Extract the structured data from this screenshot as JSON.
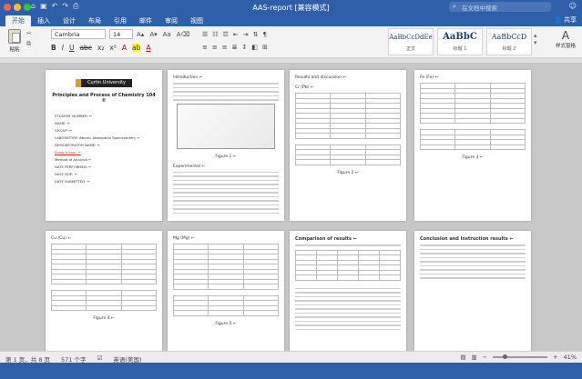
{
  "window": {
    "title": "AAS-report [兼容模式]",
    "search_placeholder": "在文档中搜索"
  },
  "tabs": [
    "开始",
    "插入",
    "设计",
    "布局",
    "引用",
    "邮件",
    "审阅",
    "视图"
  ],
  "share_label": "共享",
  "ribbon": {
    "paste_label": "粘贴",
    "font": "Cambria",
    "size": "14",
    "styles": [
      {
        "preview": "AaBbCcDdEe",
        "name": "正文"
      },
      {
        "preview": "AaBbC",
        "name": "标题 1"
      },
      {
        "preview": "AaBbCcD",
        "name": "标题 2"
      }
    ],
    "style_pane_label": "样式窗格"
  },
  "pages": {
    "cover": {
      "logo_text": "Curtin University",
      "title": "Principles and Process of Chemistry 104 ©",
      "fields": [
        "STUDENT NUMBER: ←",
        "NAME: ←",
        "GROUP: ←",
        "LABORATORY: Atomic Absorption Spectrometry ←",
        "DEMONSTRATOR NAME: ←",
        "Show in box: ←",
        "Method of Analysis ←",
        "DATE PERFORMED: ←",
        "DATE DUE: ←",
        "DATE SUBMITTED: ←"
      ]
    },
    "p2": {
      "heading": "Introduction ←",
      "heading2": "Experimental ←",
      "fig_caption": "Figure 1 ←"
    },
    "p3": {
      "heading": "Results and discussion ←",
      "subheading": "Cr (Pb) ←",
      "fig_caption": "Figure 2 ←"
    },
    "p4": {
      "heading": "Fe (Fe) ←",
      "fig_caption": "Figure 3 ←"
    },
    "p5": {
      "heading": "Cu (Cu) ←",
      "fig_caption": "Figure 4 ←"
    },
    "p6": {
      "heading": "Mg (Mg) ←",
      "fig_caption": "Figure 5 ←"
    },
    "p7": {
      "heading": "Comparison of results ←"
    },
    "p8": {
      "heading": "Conclusion and Instruction results ←"
    }
  },
  "status": {
    "page": "第 1 页，共 8 页",
    "words": "571 个字",
    "lang": "英语(美国)",
    "zoom": "41%",
    "zoom_level": 41
  }
}
